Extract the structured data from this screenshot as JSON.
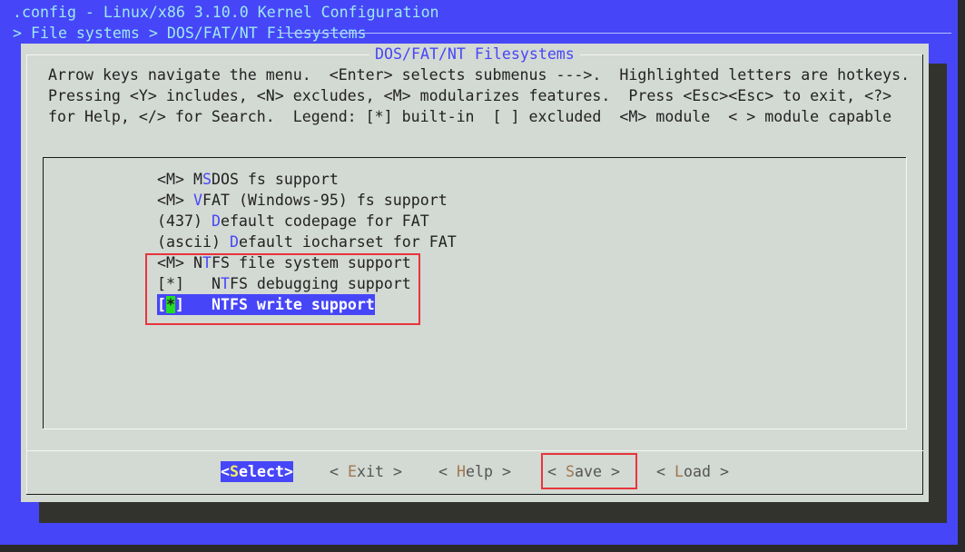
{
  "header": {
    "title": ".config - Linux/x86 3.10.0 Kernel Configuration",
    "breadcrumb": "> File systems > DOS/FAT/NT Filesystems"
  },
  "dialog": {
    "title": "DOS/FAT/NT Filesystems",
    "help_lines": [
      "Arrow keys navigate the menu.  <Enter> selects submenus --->.  Highlighted letters are hotkeys.",
      "Pressing <Y> includes, <N> excludes, <M> modularizes features.  Press <Esc><Esc> to exit, <?>",
      "for Help, </> for Search.  Legend: [*] built-in  [ ] excluded  <M> module  < > module capable"
    ],
    "items": [
      {
        "state": "<M>",
        "pre": " M",
        "hot": "S",
        "post": "DOS fs support"
      },
      {
        "state": "<M>",
        "pre": " ",
        "hot": "V",
        "post": "FAT (Windows-95) fs support"
      },
      {
        "state": "(437)",
        "pre": " ",
        "hot": "D",
        "post": "efault codepage for FAT"
      },
      {
        "state": "(ascii)",
        "pre": " ",
        "hot": "D",
        "post": "efault iocharset for FAT"
      },
      {
        "state": "<M>",
        "pre": " N",
        "hot": "T",
        "post": "FS file system support"
      },
      {
        "state": "[*]",
        "pre": "   N",
        "hot": "T",
        "post": "FS debugging support"
      },
      {
        "state_open": "[",
        "state_mark": "*",
        "state_close": "]",
        "pre": "   NTFS write support",
        "selected": true
      }
    ],
    "buttons": [
      {
        "open": "<",
        "hot": "S",
        "rest": "elect",
        "close": ">",
        "selected": true
      },
      {
        "open": "< ",
        "hot": "E",
        "rest": "xit",
        "close": " >"
      },
      {
        "open": "< ",
        "hot": "H",
        "rest": "elp",
        "close": " >"
      },
      {
        "open": "< ",
        "hot": "S",
        "rest": "ave",
        "close": " >"
      },
      {
        "open": "< ",
        "hot": "L",
        "rest": "oad",
        "close": " >"
      }
    ]
  },
  "colors": {
    "background": "#4646f8",
    "dialog": "#d3d9d3",
    "hotkey": "#4646f8",
    "highlight": "#22dd22",
    "annotation": "#e8343c"
  }
}
